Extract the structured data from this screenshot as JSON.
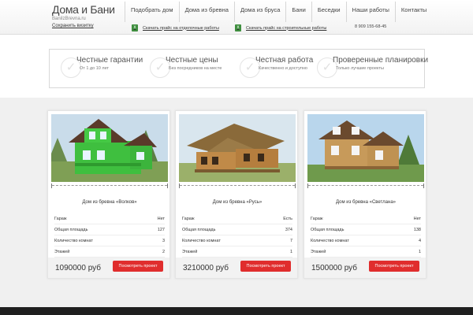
{
  "header": {
    "logo_title": "Дома и Бани",
    "logo_subtitle": "BaniIzBrevna.ru",
    "save_card": "Сохранить визитку",
    "nav": [
      "Подобрать дом",
      "Дома из бревна",
      "Дома из бруса",
      "Бани",
      "Беседки",
      "Наши работы",
      "Контакты"
    ],
    "download_1": "Скачать прайс на отделочные работы",
    "download_2": "Скачать прайс на строительные работы",
    "download_icon": "excel-icon",
    "phone": "8 909 155-68-45"
  },
  "features": [
    {
      "title": "Честные гарантии",
      "subtitle": "От 1 до 10 лет",
      "icon": "checkmark-icon"
    },
    {
      "title": "Честные цены",
      "subtitle": "Без посредников на месте",
      "icon": "checkmark-icon"
    },
    {
      "title": "Честная работа",
      "subtitle": "Качественно и доступно",
      "icon": "checkmark-icon"
    },
    {
      "title": "Проверенные планировки",
      "subtitle": "Только лучшие проекты",
      "icon": "checkmark-icon"
    }
  ],
  "products": [
    {
      "title": "Дом из бревна «Волков»",
      "specs": [
        {
          "label": "Гараж",
          "value": "Нет"
        },
        {
          "label": "Общая площадь",
          "value": "127"
        },
        {
          "label": "Количество комнат",
          "value": "3"
        },
        {
          "label": "Этажей",
          "value": "2"
        }
      ],
      "price": "1090000 руб",
      "button": "Посмотреть проект"
    },
    {
      "title": "Дом из бревна «Русь»",
      "specs": [
        {
          "label": "Гараж",
          "value": "Есть"
        },
        {
          "label": "Общая площадь",
          "value": "374"
        },
        {
          "label": "Количество комнат",
          "value": "7"
        },
        {
          "label": "Этажей",
          "value": "1"
        }
      ],
      "price": "3210000 руб",
      "button": "Посмотреть проект"
    },
    {
      "title": "Дом из бревна «Светлана»",
      "specs": [
        {
          "label": "Гараж",
          "value": "Нет"
        },
        {
          "label": "Общая площадь",
          "value": "138"
        },
        {
          "label": "Количество комнат",
          "value": "4"
        },
        {
          "label": "Этажей",
          "value": "1"
        }
      ],
      "price": "1500000 руб",
      "button": "Посмотреть проект"
    }
  ],
  "colors": {
    "accent_button": "#e02d2d",
    "excel_icon": "#3f8f3f",
    "bottom_bar": "#1f1f1f"
  }
}
